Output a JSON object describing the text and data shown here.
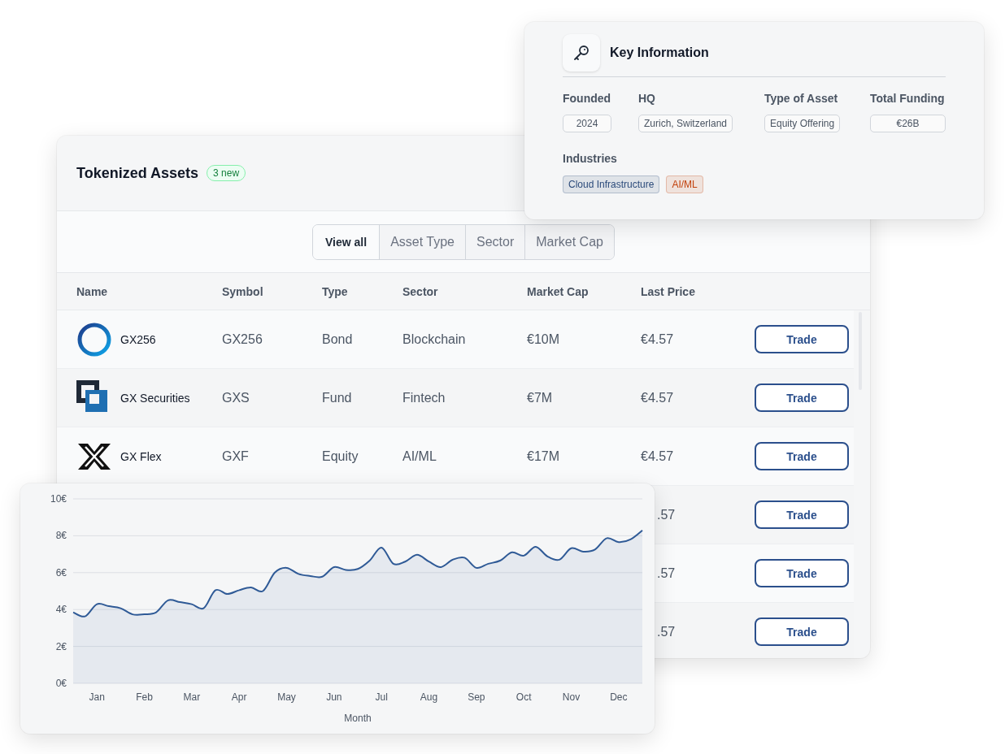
{
  "assets_card": {
    "title": "Tokenized Assets",
    "badge": "3 new",
    "filters": [
      {
        "label": "View all",
        "selected": true
      },
      {
        "label": "Asset Type",
        "selected": false
      },
      {
        "label": "Sector",
        "selected": false
      },
      {
        "label": "Market Cap",
        "selected": false
      }
    ],
    "columns": [
      "Name",
      "Symbol",
      "Type",
      "Sector",
      "Market Cap",
      "Last Price"
    ],
    "rows": [
      {
        "kind": "ring",
        "name": "GX256",
        "symbol": "GX256",
        "type": "Bond",
        "sector": "Blockchain",
        "market_cap": "€10M",
        "last_price": "€4.57",
        "action": "Trade"
      },
      {
        "kind": "squares",
        "name": "GX Securities",
        "symbol": "GXS",
        "type": "Fund",
        "sector": "Fintech",
        "market_cap": "€7M",
        "last_price": "€4.57",
        "action": "Trade"
      },
      {
        "kind": "cross",
        "name": "GX Flex",
        "symbol": "GXF",
        "type": "Equity",
        "sector": "AI/ML",
        "market_cap": "€17M",
        "last_price": "€4.57",
        "action": "Trade"
      },
      {
        "last_price": ".57",
        "action": "Trade"
      },
      {
        "last_price": ".57",
        "action": "Trade"
      },
      {
        "last_price": ".57",
        "action": "Trade"
      }
    ]
  },
  "key_info": {
    "title": "Key Information",
    "fields": [
      {
        "label": "Founded",
        "value": "2024"
      },
      {
        "label": "HQ",
        "value": "Zurich, Switzerland"
      },
      {
        "label": "Type of Asset",
        "value": "Equity Offering"
      },
      {
        "label": "Total Funding",
        "value": "€26B"
      }
    ],
    "industries_label": "Industries",
    "industries": [
      {
        "label": "Cloud Infrastructure",
        "color": "#2b4a7a"
      },
      {
        "label": "AI/ML",
        "color": "#c2410c"
      }
    ]
  },
  "price_chart": {
    "chart_data": {
      "type": "area",
      "grid": true,
      "xlabel": "Month",
      "ylim": [
        0,
        10
      ],
      "yticks": [
        {
          "value": 0,
          "label": "0€"
        },
        {
          "value": 2,
          "label": "2€"
        },
        {
          "value": 4,
          "label": "4€"
        },
        {
          "value": 6,
          "label": "6€"
        },
        {
          "value": 8,
          "label": "8€"
        },
        {
          "value": 10,
          "label": "10€"
        }
      ],
      "categories": [
        null,
        null,
        "Jan",
        null,
        null,
        null,
        "Feb",
        null,
        null,
        null,
        "Mar",
        null,
        null,
        null,
        "Apr",
        null,
        null,
        null,
        "May",
        null,
        null,
        null,
        "Jun",
        null,
        null,
        null,
        "Jul",
        null,
        null,
        null,
        "Aug",
        null,
        null,
        null,
        "Sep",
        null,
        null,
        null,
        "Oct",
        null,
        null,
        null,
        "Nov",
        null,
        null,
        null,
        "Dec",
        null,
        null
      ],
      "series": [
        {
          "color": "#2f5a96",
          "values": [
            3.85,
            3.63,
            4.29,
            4.18,
            4.07,
            3.74,
            3.74,
            3.85,
            4.5,
            4.4,
            4.29,
            4.07,
            5.05,
            4.84,
            5.05,
            5.2,
            5.0,
            6.0,
            6.26,
            5.93,
            5.82,
            5.78,
            6.3,
            6.15,
            6.2,
            6.65,
            7.36,
            6.48,
            6.6,
            6.97,
            6.6,
            6.3,
            6.7,
            6.81,
            6.26,
            6.48,
            6.65,
            7.1,
            6.92,
            7.4,
            6.88,
            6.7,
            7.32,
            7.14,
            7.25,
            7.87,
            7.65,
            7.8,
            8.29
          ]
        }
      ]
    }
  }
}
